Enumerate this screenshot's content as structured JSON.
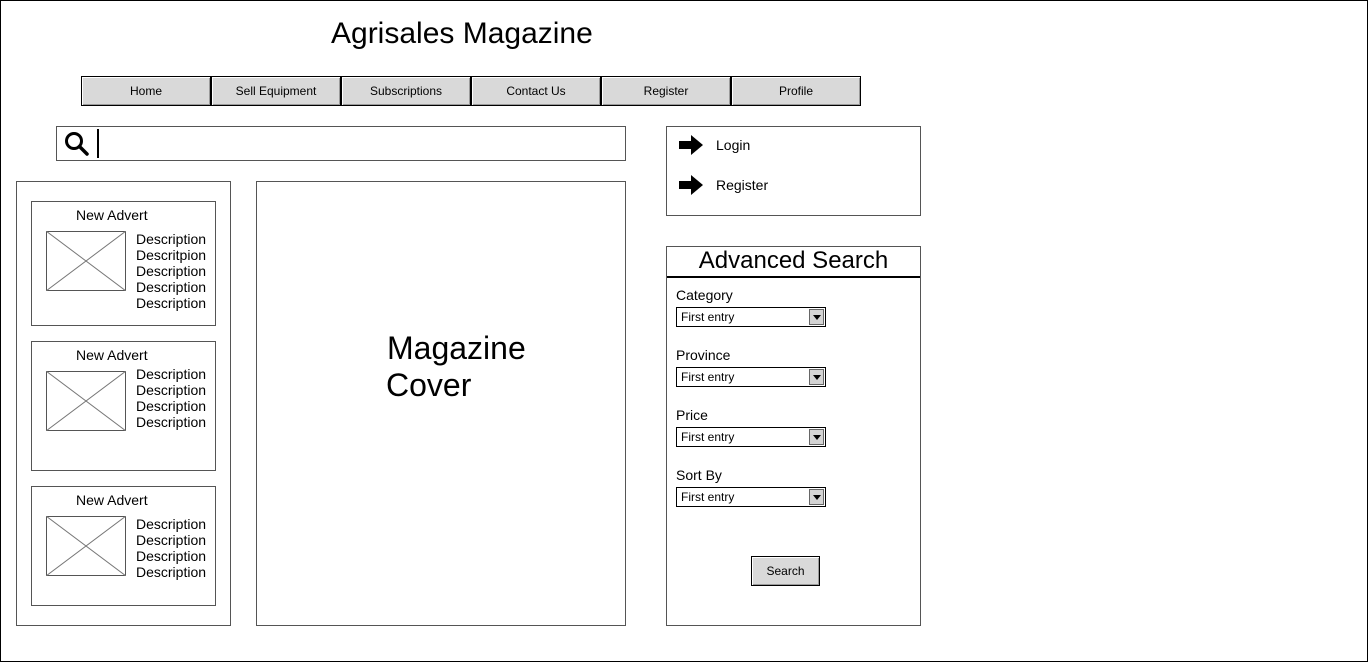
{
  "header": {
    "title": "Agrisales Magazine"
  },
  "nav": {
    "items": [
      {
        "label": "Home"
      },
      {
        "label": "Sell Equipment"
      },
      {
        "label": "Subscriptions"
      },
      {
        "label": "Contact Us"
      },
      {
        "label": "Register"
      },
      {
        "label": "Profile"
      }
    ]
  },
  "search": {
    "value": "",
    "icon": "search-icon"
  },
  "adverts": [
    {
      "title": "New Advert",
      "descriptions": [
        "Description",
        "Descritpion",
        "Description",
        "Description",
        "Description"
      ]
    },
    {
      "title": "New Advert",
      "descriptions": [
        "Description",
        "Description",
        "Description",
        "Description"
      ]
    },
    {
      "title": "New Advert",
      "descriptions": [
        "Description",
        "Description",
        "Description",
        "Description"
      ]
    }
  ],
  "cover": {
    "line1": "Magazine",
    "line2": "Cover"
  },
  "account": {
    "links": [
      {
        "label": "Login",
        "icon": "arrow-right-icon"
      },
      {
        "label": "Register",
        "icon": "arrow-right-icon"
      }
    ]
  },
  "advanced_search": {
    "title": "Advanced Search",
    "fields": [
      {
        "label": "Category",
        "selected": "First entry"
      },
      {
        "label": "Province",
        "selected": "First entry"
      },
      {
        "label": "Price",
        "selected": "First entry"
      },
      {
        "label": "Sort By",
        "selected": "First entry"
      }
    ],
    "button_label": "Search"
  }
}
